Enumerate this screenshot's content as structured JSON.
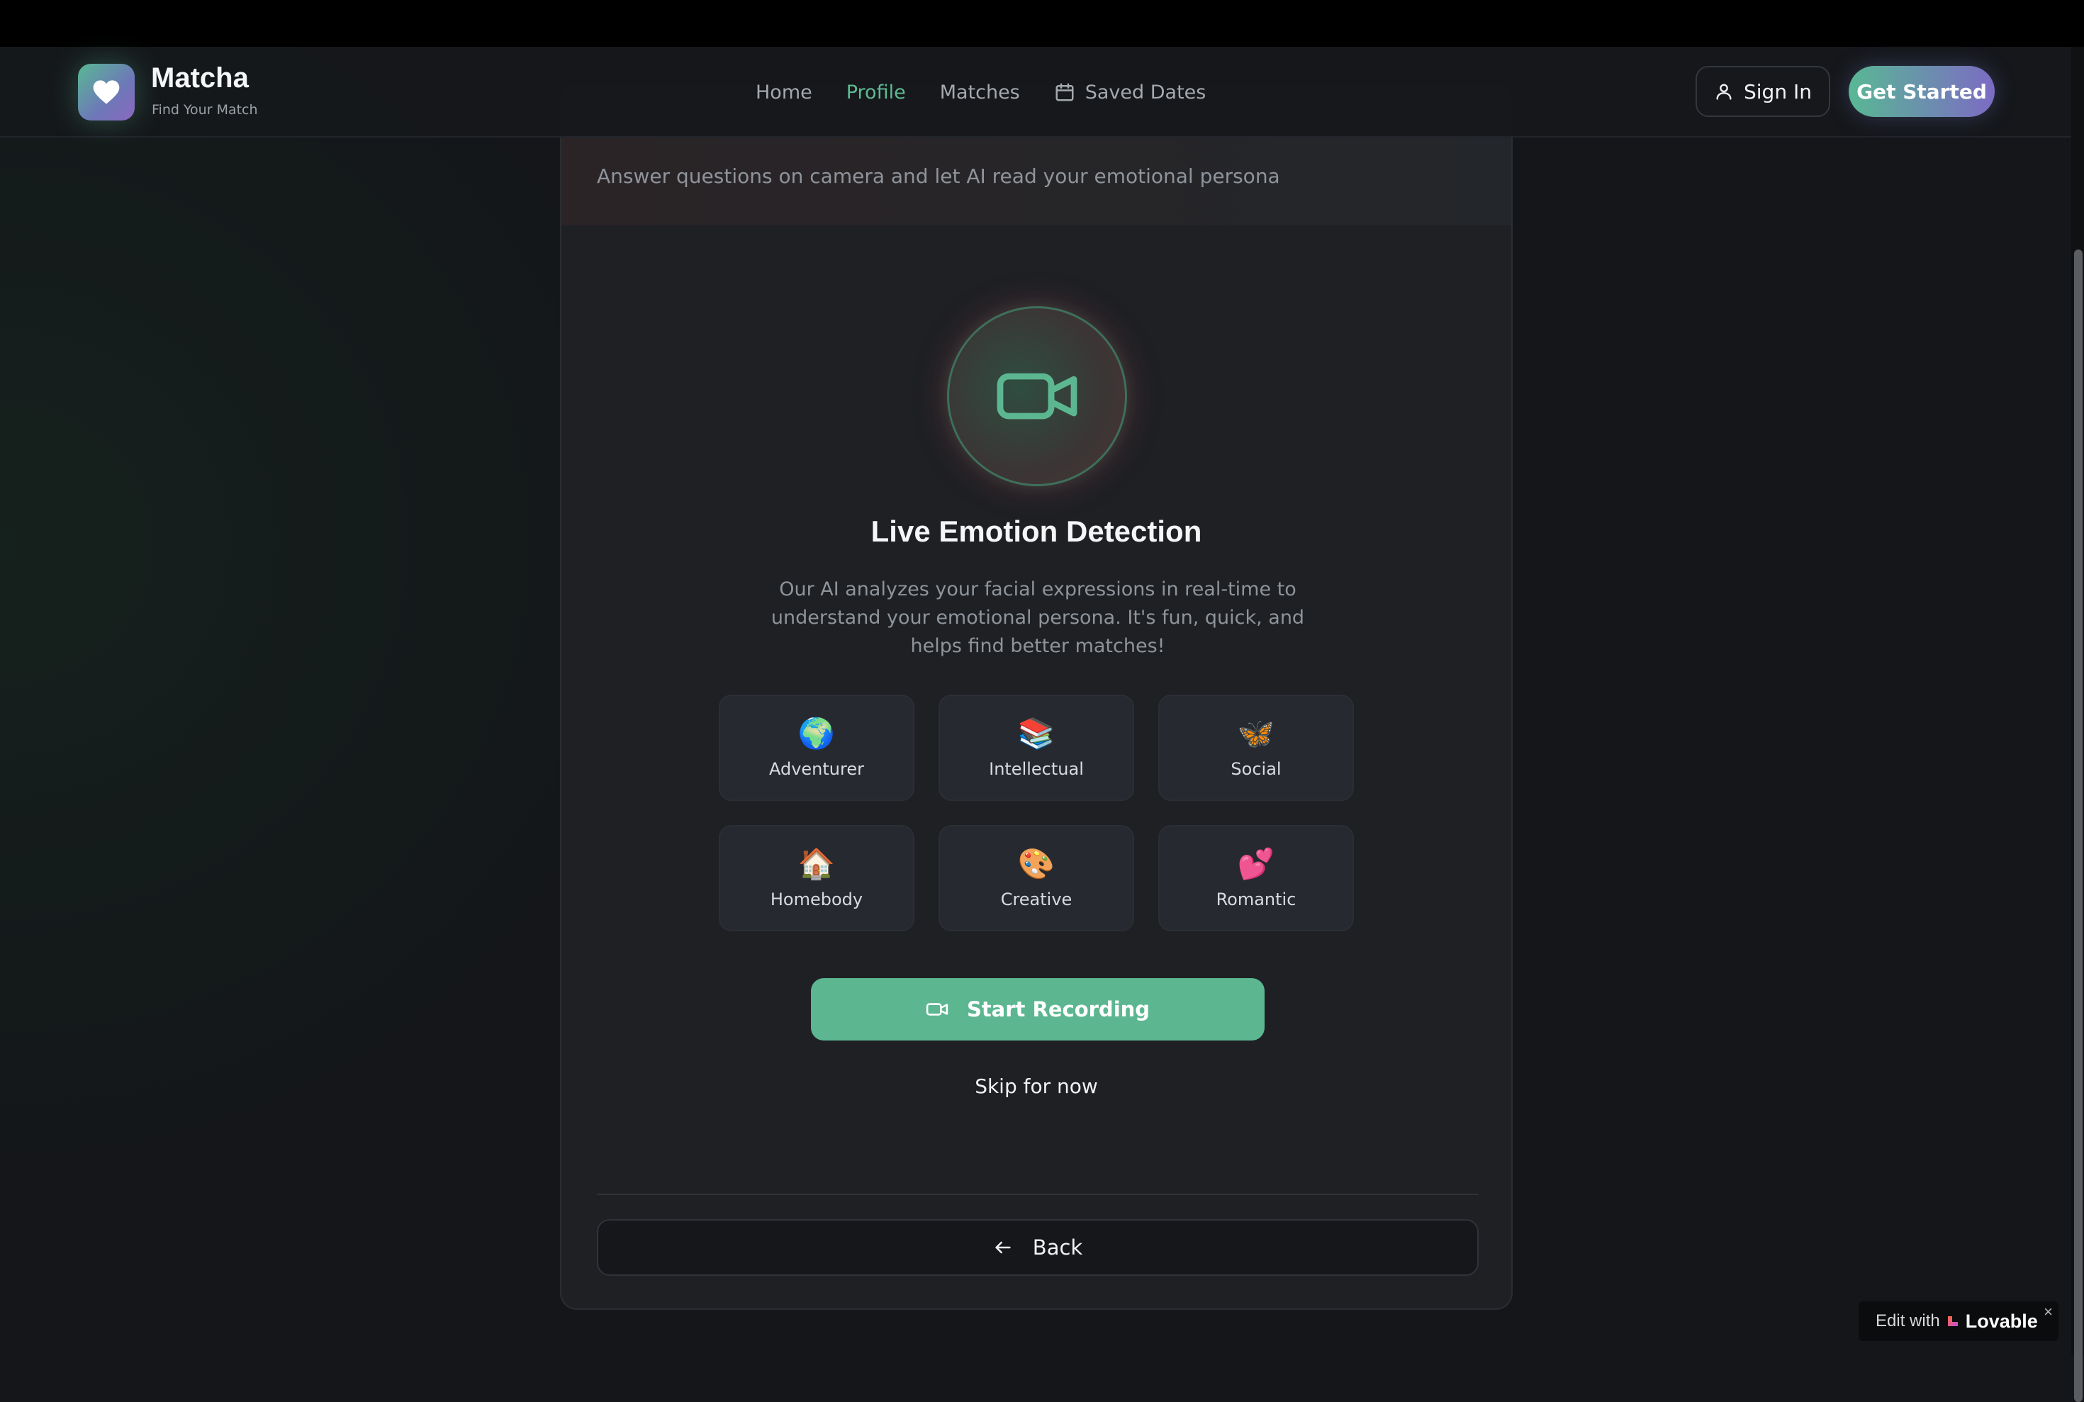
{
  "nav": {
    "brand": "Matcha",
    "tagline": "Find Your Match",
    "links": [
      "Home",
      "Profile",
      "Matches",
      "Saved Dates"
    ],
    "active": "Profile",
    "signin": "Sign In",
    "cta": "Get Started"
  },
  "card": {
    "subtitle": "Answer questions on camera and let AI read your emotional persona",
    "title": "Live Emotion Detection",
    "description": "Our AI analyzes your facial expressions in real-time to understand your emotional persona. It's fun, quick, and helps find better matches!",
    "personas": [
      {
        "emoji": "🌍",
        "label": "Adventurer"
      },
      {
        "emoji": "📚",
        "label": "Intellectual"
      },
      {
        "emoji": "🦋",
        "label": "Social"
      },
      {
        "emoji": "🏠",
        "label": "Homebody"
      },
      {
        "emoji": "🎨",
        "label": "Creative"
      },
      {
        "emoji": "💕",
        "label": "Romantic"
      }
    ],
    "record_label": "Start Recording",
    "skip_label": "Skip for now",
    "back_label": "Back"
  },
  "badge": {
    "prefix": "Edit with",
    "brand": "Lovable",
    "close": "×"
  },
  "colors": {
    "accent": "#5cb791",
    "gradient_end": "#7c6bc4",
    "background": "#141619",
    "card": "#1e2024"
  }
}
